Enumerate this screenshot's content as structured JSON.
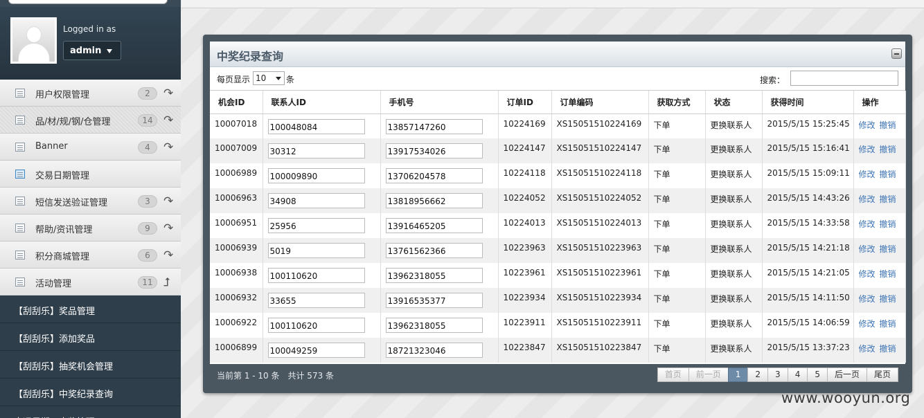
{
  "sidebar": {
    "logged_in_label": "Logged in as",
    "username": "admin",
    "menu": [
      {
        "label": "用户权限管理",
        "count": "2",
        "arrow": "↷"
      },
      {
        "label": "品/材/规/钢/仓管理",
        "count": "14",
        "arrow": "↷"
      },
      {
        "label": "Banner",
        "count": "4",
        "arrow": "↷"
      },
      {
        "label": "交易日期管理",
        "count": "",
        "arrow": ""
      },
      {
        "label": "短信发送验证管理",
        "count": "3",
        "arrow": "↷"
      },
      {
        "label": "帮助/资讯管理",
        "count": "9",
        "arrow": "↷"
      },
      {
        "label": "积分商城管理",
        "count": "6",
        "arrow": "↷"
      },
      {
        "label": "活动管理",
        "count": "11",
        "arrow": "⮥"
      }
    ],
    "submenu": [
      "【刮刮乐】奖品管理",
      "【刮刮乐】添加奖品",
      "【刮刮乐】抽奖机会管理",
      "【刮刮乐】中奖纪录查询",
      "大运星期二大奖管理"
    ]
  },
  "panel": {
    "title": "中奖纪录查询",
    "per_page_label": "每页显示",
    "per_page_value": "10",
    "per_page_unit": "条",
    "search_label": "搜索："
  },
  "table": {
    "headers": [
      "机会ID",
      "联系人ID",
      "手机号",
      "订单ID",
      "订单编码",
      "获取方式",
      "状态",
      "获得时间",
      "操作"
    ],
    "rows": [
      [
        "10007018",
        "100048084",
        "13857147260",
        "10224169",
        "XS15051510224169",
        "下单",
        "更换联系人",
        "2015/5/15 15:25:45"
      ],
      [
        "10007009",
        "30312",
        "13917534026",
        "10224147",
        "XS15051510224147",
        "下单",
        "更换联系人",
        "2015/5/15 15:16:41"
      ],
      [
        "10006989",
        "100009890",
        "13706204578",
        "10224118",
        "XS15051510224118",
        "下单",
        "更换联系人",
        "2015/5/15 15:09:11"
      ],
      [
        "10006963",
        "34908",
        "13818956662",
        "10224052",
        "XS15051510224052",
        "下单",
        "更换联系人",
        "2015/5/15 14:43:26"
      ],
      [
        "10006951",
        "25956",
        "13916465205",
        "10224013",
        "XS15051510224013",
        "下单",
        "更换联系人",
        "2015/5/15 14:33:58"
      ],
      [
        "10006939",
        "5019",
        "13761562366",
        "10223963",
        "XS15051510223963",
        "下单",
        "更换联系人",
        "2015/5/15 14:21:18"
      ],
      [
        "10006938",
        "100110620",
        "13962318055",
        "10223961",
        "XS15051510223961",
        "下单",
        "更换联系人",
        "2015/5/15 14:21:05"
      ],
      [
        "10006932",
        "33655",
        "13916535377",
        "10223934",
        "XS15051510223934",
        "下单",
        "更换联系人",
        "2015/5/15 14:11:50"
      ],
      [
        "10006922",
        "100110620",
        "13962318055",
        "10223911",
        "XS15051510223911",
        "下单",
        "更换联系人",
        "2015/5/15 14:06:59"
      ],
      [
        "10006899",
        "100049259",
        "18721323046",
        "10223847",
        "XS15051510223847",
        "下单",
        "更换联系人",
        "2015/5/15 13:37:23"
      ]
    ],
    "action_edit": "修改",
    "action_revoke": "撤销"
  },
  "footer": {
    "info": "当前第 1 - 10 条　共计 573 条",
    "pager": [
      "首页",
      "前一页",
      "1",
      "2",
      "3",
      "4",
      "5",
      "后一页",
      "尾页"
    ]
  },
  "watermark": "www.wooyun.org",
  "colors": {
    "sidebar_bg": "#2f3f4c",
    "panel_frame": "#4a5660",
    "link": "#3d74b5",
    "pager_current": "#6d8aa6"
  }
}
